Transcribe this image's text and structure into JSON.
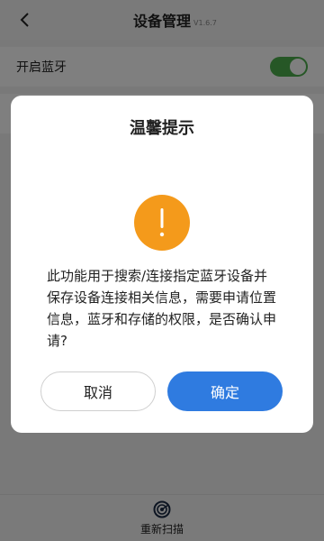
{
  "header": {
    "title": "设备管理",
    "version": "V1.6.7",
    "back_icon": "chevron-left-icon"
  },
  "bluetooth": {
    "label": "开启蓝牙",
    "enabled": true
  },
  "bottom_bar": {
    "rescan_label": "重新扫描",
    "rescan_icon": "radar-scan-icon"
  },
  "dialog": {
    "title": "温馨提示",
    "icon": "warning-exclamation-icon",
    "icon_color": "#f49a1b",
    "message": "此功能用于搜索/连接指定蓝牙设备并保存设备连接相关信息，需要申请位置信息，蓝牙和存储的权限，是否确认申请?",
    "cancel_label": "取消",
    "confirm_label": "确定"
  },
  "colors": {
    "accent": "#2f7be0",
    "switch_on": "#4cae4c"
  }
}
